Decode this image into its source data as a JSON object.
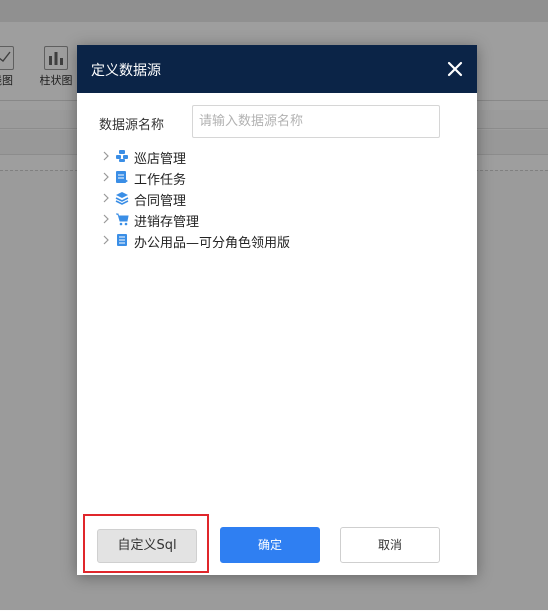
{
  "background": {
    "toolbar": [
      {
        "label": "线图",
        "icon": "line-chart-icon"
      },
      {
        "label": "柱状图",
        "icon": "bar-chart-icon"
      }
    ]
  },
  "dialog": {
    "title": "定义数据源",
    "close_icon": "close-icon",
    "name_field": {
      "label": "数据源名称",
      "value": "",
      "placeholder": "请输入数据源名称"
    },
    "tree": [
      {
        "label": "巡店管理",
        "icon": "store-patrol-icon",
        "color": "#3a8ee6"
      },
      {
        "label": "工作任务",
        "icon": "task-icon",
        "color": "#3a8ee6"
      },
      {
        "label": "合同管理",
        "icon": "layers-icon",
        "color": "#3a8ee6"
      },
      {
        "label": "进销存管理",
        "icon": "cart-icon",
        "color": "#3a8ee6"
      },
      {
        "label": "办公用品—可分角色领用版",
        "icon": "document-icon",
        "color": "#3a8ee6"
      }
    ],
    "buttons": {
      "custom_sql": "自定义Sql",
      "confirm": "确定",
      "cancel": "取消"
    }
  },
  "colors": {
    "header": "#0b2447",
    "primary": "#2f7ff2",
    "highlight": "#e0262b"
  }
}
